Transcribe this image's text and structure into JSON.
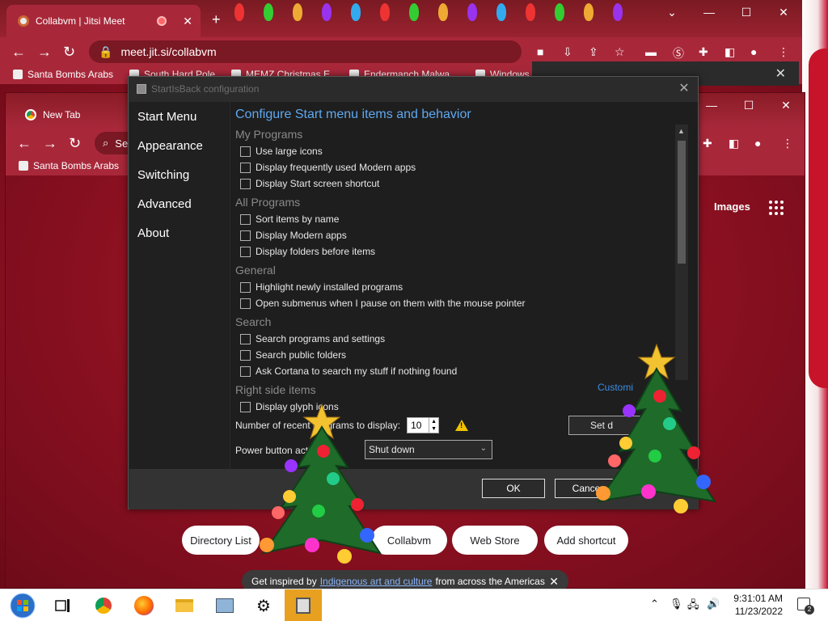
{
  "browser_back": {
    "tab_title": "Collabvm | Jitsi Meet",
    "url": "meet.jit.si/collabvm",
    "bookmarks": [
      "Santa Bombs Arabs",
      "South Hard Pole",
      "MEMZ Christmas E...",
      "Endermanch Malwa...",
      "Windows"
    ]
  },
  "browser_front": {
    "tab_title": "New Tab",
    "search_partial": "Se",
    "bookmarks": [
      "Santa Bombs Arabs"
    ],
    "images_link": "Images",
    "shortcuts": [
      "Directory List",
      "Collabvm",
      "Web Store",
      "Add shortcut"
    ],
    "banner": {
      "prefix": "Get inspired by",
      "link": "Indigenous art and culture",
      "suffix": "from across the Americas"
    }
  },
  "dialog": {
    "title": "StartIsBack configuration",
    "sidebar": [
      "Start Menu",
      "Appearance",
      "Switching",
      "Advanced",
      "About"
    ],
    "heading": "Configure Start menu items and behavior",
    "sections": [
      {
        "title": "My Programs",
        "options": [
          "Use large icons",
          "Display frequently used Modern apps",
          "Display Start screen shortcut"
        ]
      },
      {
        "title": "All Programs",
        "options": [
          "Sort items by name",
          "Display Modern apps",
          "Display folders before items"
        ]
      },
      {
        "title": "General",
        "options": [
          "Highlight newly installed programs",
          "Open submenus when I pause on them with the mouse pointer"
        ]
      },
      {
        "title": "Search",
        "options": [
          "Search programs and settings",
          "Search public folders",
          "Ask Cortana to search my stuff if nothing found"
        ]
      },
      {
        "title": "Right side items",
        "options": [
          "Display glyph icons"
        ]
      }
    ],
    "customize_link": "Customi",
    "recent_label": "Number of recent programs to display:",
    "recent_value": "10",
    "set_default_label": "Set d",
    "power_label": "Power button action:",
    "power_value": "Shut down",
    "ok_label": "OK",
    "cancel_label": "Cance"
  },
  "taskbar": {
    "time": "9:31:01 AM",
    "date": "11/23/2022",
    "notification_count": "2"
  },
  "colors": {
    "dialog_accent": "#5fa8f0",
    "browser_red": "#a8283a",
    "taskbar_active": "#e8a020"
  }
}
